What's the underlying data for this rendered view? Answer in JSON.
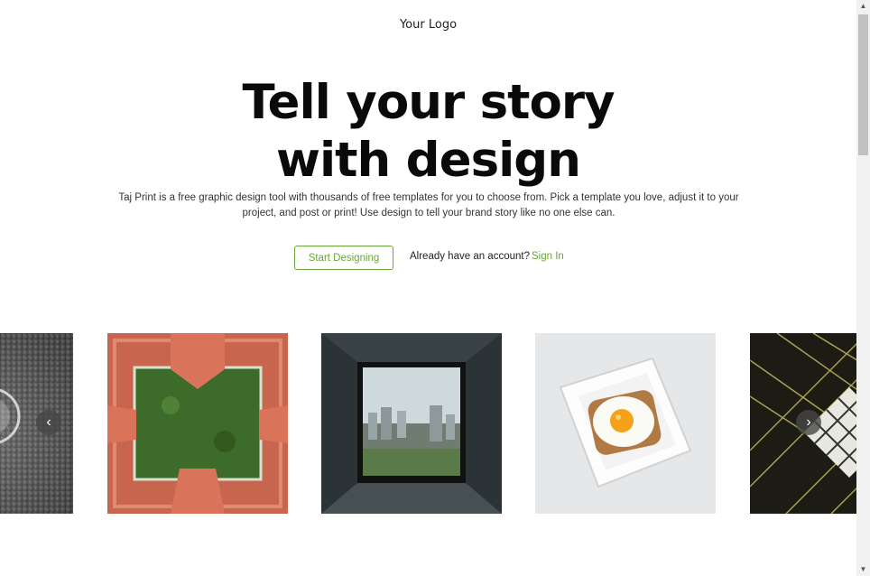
{
  "header": {
    "logo": "Your Logo"
  },
  "hero": {
    "title_line1": "Tell your story",
    "title_line2": "with design",
    "description": "Taj Print is a free graphic design tool with thousands of free templates for you to choose from. Pick a template you love, adjust it to your project, and post or print! Use design to tell your brand story like no one else can."
  },
  "cta": {
    "start_label": "Start Designing",
    "account_prompt": "Already have an account?",
    "signin_label": "Sign In"
  },
  "carousel": {
    "prev_icon": "chevron-left-icon",
    "next_icon": "chevron-right-icon",
    "prev_glyph": "‹",
    "next_glyph": "›",
    "images": [
      "glass-bw-photo",
      "courtyard-aerial-photo",
      "city-window-photo",
      "fried-egg-toast-photo",
      "skylight-grid-photo"
    ]
  },
  "colors": {
    "accent": "#6aa63a",
    "text": "#0a0a0a"
  }
}
